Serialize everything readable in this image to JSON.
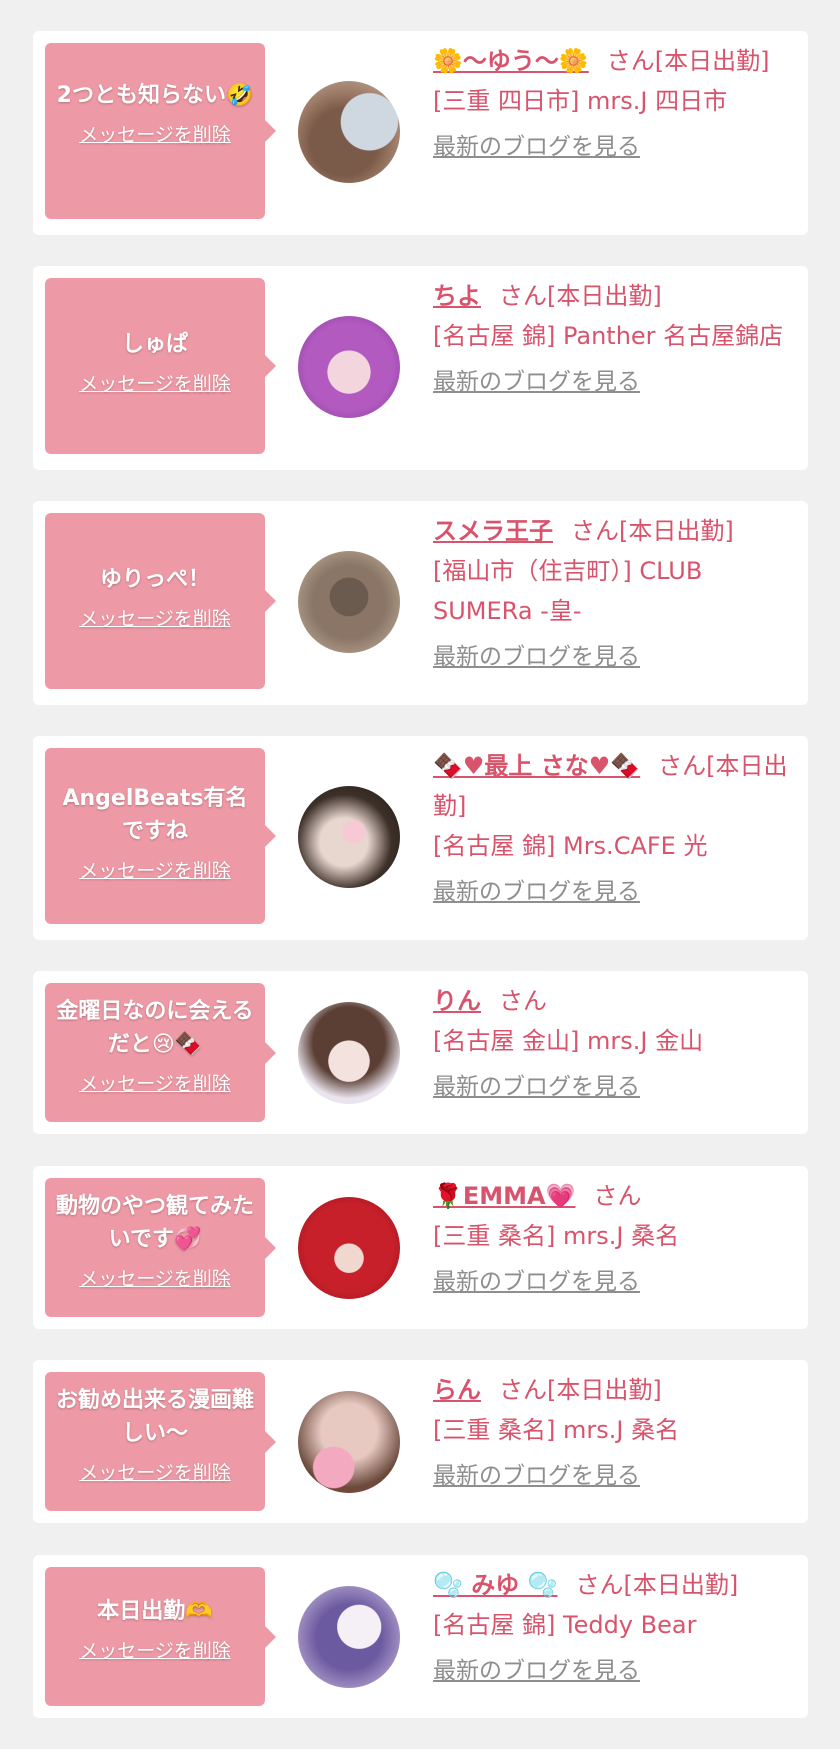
{
  "delete_label": "メッセージを削除",
  "blog_label": "最新のブログを見る",
  "san_label": "さん",
  "items": [
    {
      "message": "2つとも知らない🤣",
      "name": "🌼〜ゆう〜🌼",
      "suffix": "[本日出勤]",
      "shop": "[三重 四日市] mrs.J 四日市"
    },
    {
      "message": "しゅぱ",
      "name": "ちよ",
      "suffix": "[本日出勤]",
      "shop": "[名古屋 錦] Panther 名古屋錦店"
    },
    {
      "message": "ゆりっぺ！",
      "name": "スメラ王子",
      "suffix": "[本日出勤]",
      "shop": "[福山市（住吉町）] CLUB SUMERa -皇-"
    },
    {
      "message": "AngelBeats有名ですね",
      "name": "🍫♥最上 さな♥🍫",
      "suffix": "[本日出勤]",
      "shop": "[名古屋 錦] Mrs.CAFE 光"
    },
    {
      "message": "金曜日なのに会えるだと😢🍫",
      "name": "りん",
      "suffix": "",
      "shop": "[名古屋 金山] mrs.J 金山"
    },
    {
      "message": "動物のやつ観てみたいです💞",
      "name": "🌹EMMA💗",
      "suffix": "",
      "shop": "[三重 桑名] mrs.J 桑名"
    },
    {
      "message": "お勧め出来る漫画難しい〜",
      "name": "らん",
      "suffix": "[本日出勤]",
      "shop": "[三重 桑名] mrs.J 桑名"
    },
    {
      "message": "本日出勤🫶",
      "name": "🫧 みゆ 🫧",
      "suffix": "[本日出勤]",
      "shop": "[名古屋 錦] Teddy Bear"
    }
  ]
}
